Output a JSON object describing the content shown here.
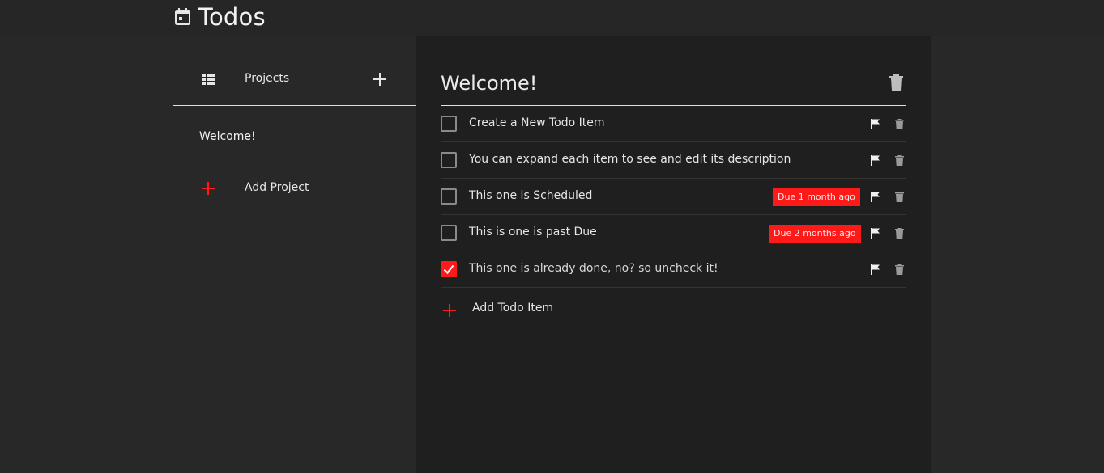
{
  "app": {
    "title": "Todos",
    "icon": "calendar-icon"
  },
  "sidebar": {
    "header_label": "Projects",
    "header_icon": "grid-icon",
    "projects": [
      {
        "name": "Welcome!"
      }
    ],
    "add_project_label": "Add Project"
  },
  "main": {
    "project_title": "Welcome!",
    "todos": [
      {
        "text": "Create a New Todo Item",
        "done": false,
        "due": ""
      },
      {
        "text": "You can expand each item to see and edit its description",
        "done": false,
        "due": ""
      },
      {
        "text": "This one is Scheduled",
        "done": false,
        "due": "Due 1 month ago"
      },
      {
        "text": "This is one is past Due",
        "done": false,
        "due": "Due 2 months ago"
      },
      {
        "text": "This one is already done, no? so uncheck it!",
        "done": true,
        "due": ""
      }
    ],
    "add_todo_label": "Add Todo Item"
  },
  "colors": {
    "accent": "#ff1a1a",
    "background": "#282828",
    "panel": "#1f1f1f",
    "text": "#e6e6e6"
  }
}
